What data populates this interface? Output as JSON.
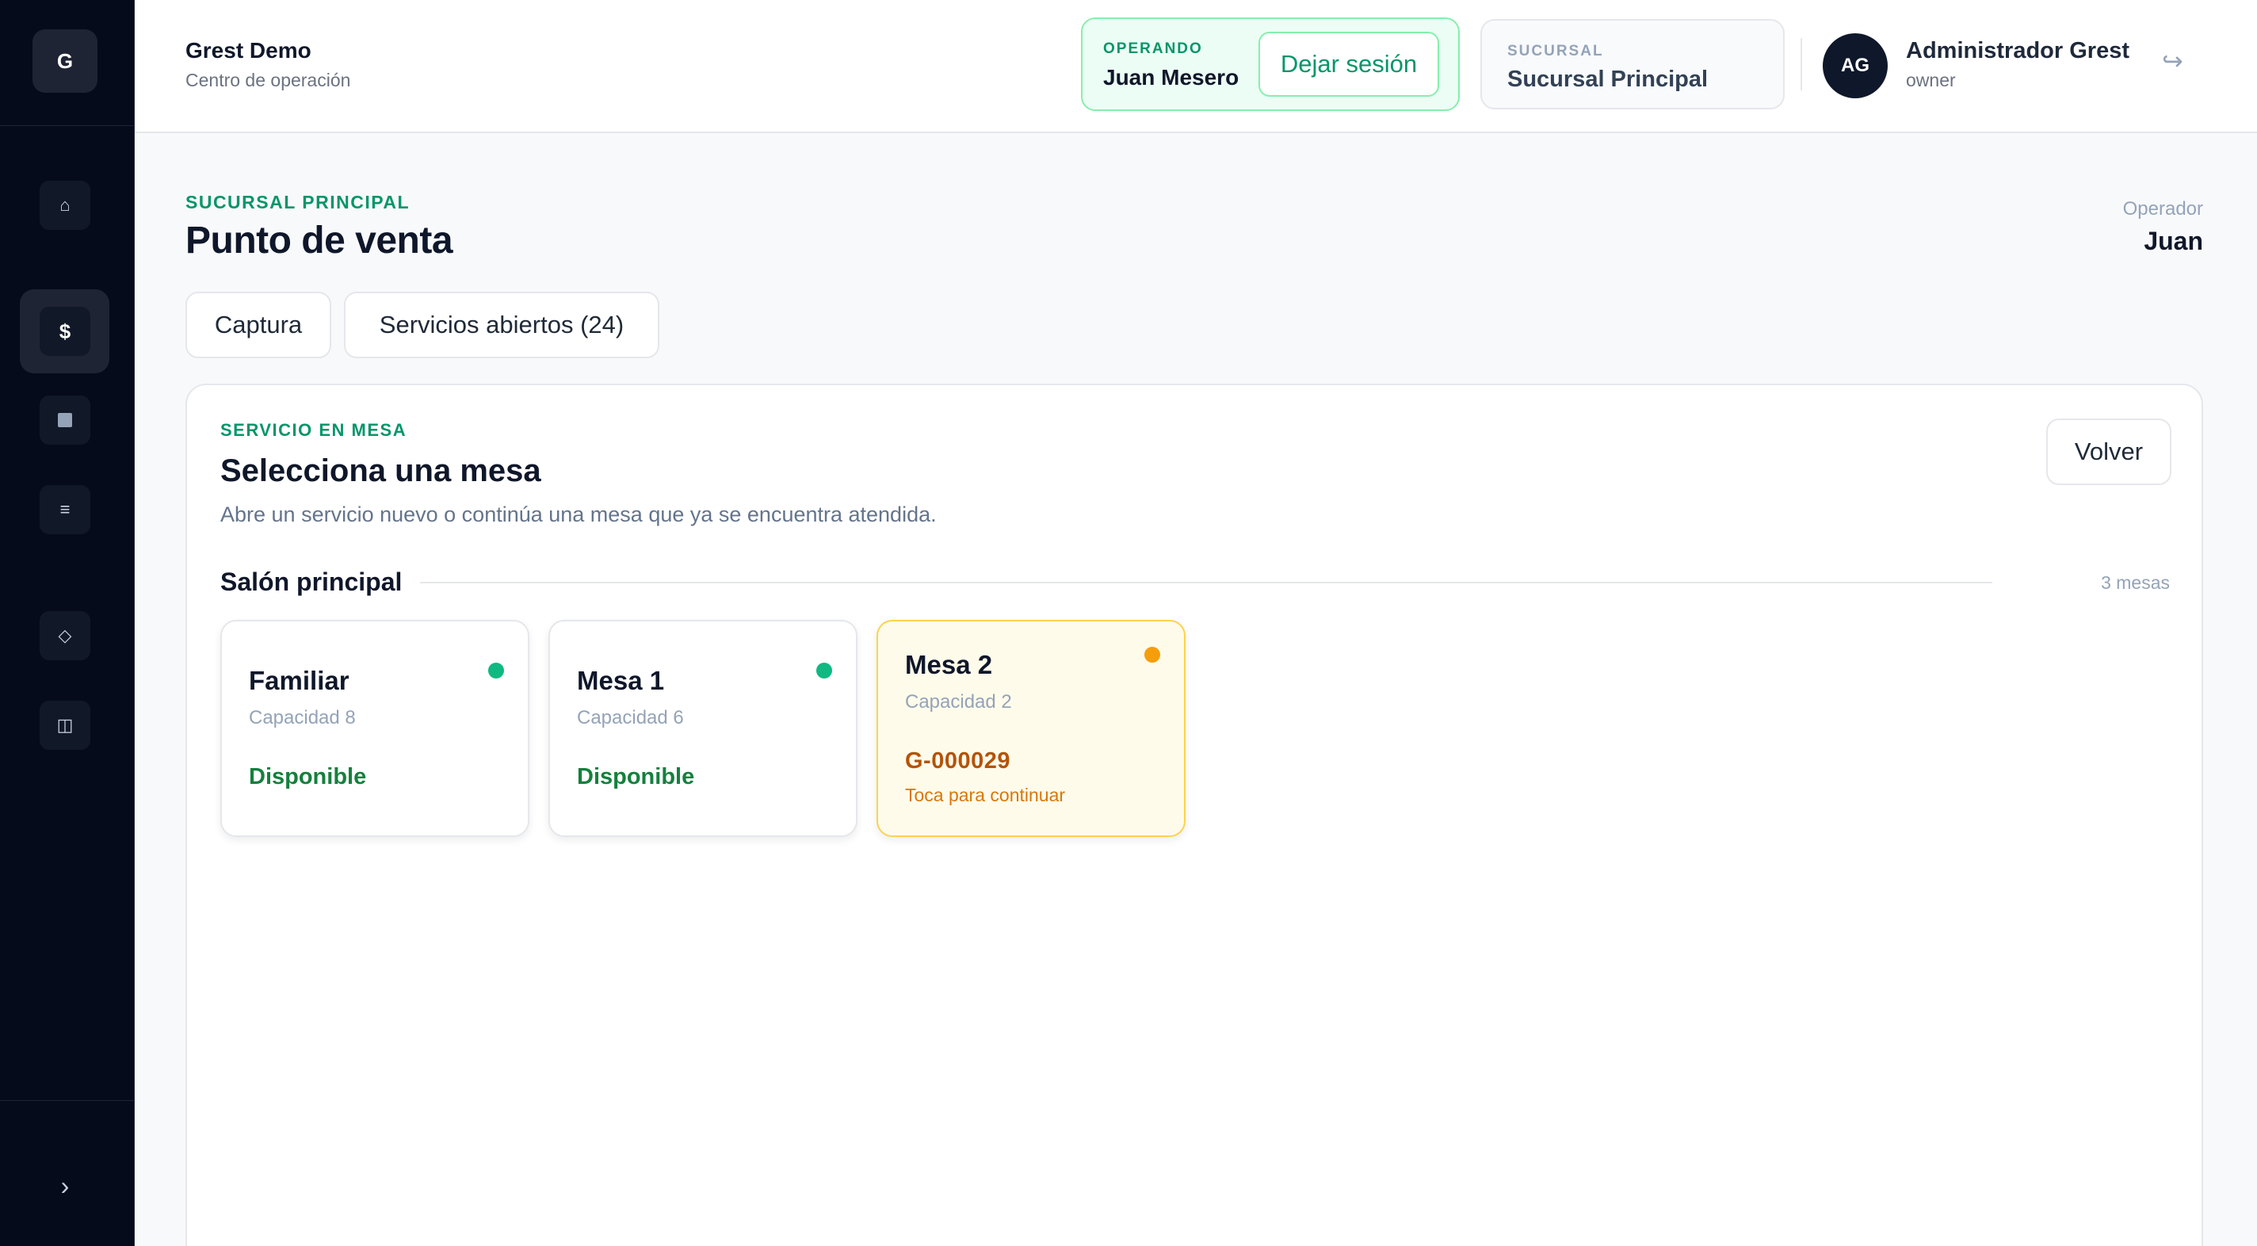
{
  "sidebar": {
    "logo": "G",
    "items": [
      {
        "name": "home",
        "icon": "home-icon",
        "glyph": "⌂"
      },
      {
        "name": "pos",
        "icon": "dollar-icon",
        "glyph": "$"
      },
      {
        "name": "tables",
        "icon": "grid-icon",
        "glyph": ""
      },
      {
        "name": "menu",
        "icon": "list-icon",
        "glyph": "≡"
      },
      {
        "name": "tags",
        "icon": "diamond-icon",
        "glyph": "◇"
      },
      {
        "name": "reports",
        "icon": "panel-icon",
        "glyph": "◫"
      }
    ],
    "collapse_glyph": "›"
  },
  "header": {
    "title": "Grest Demo",
    "subtitle": "Centro de operación",
    "operando": {
      "label": "OPERANDO",
      "name": "Juan Mesero",
      "leave_label": "Dejar sesión"
    },
    "sucursal": {
      "label": "SUCURSAL",
      "name": "Sucursal Principal"
    },
    "user": {
      "initials": "AG",
      "name": "Administrador Grest",
      "role": "owner"
    },
    "logout_glyph": "↪"
  },
  "page": {
    "eyebrow": "SUCURSAL PRINCIPAL",
    "title": "Punto de venta",
    "operator_label": "Operador",
    "operator_name": "Juan",
    "tabs": [
      {
        "label": "Captura"
      },
      {
        "label": "Servicios abiertos (24)"
      }
    ]
  },
  "panel": {
    "eyebrow": "SERVICIO EN MESA",
    "title": "Selecciona una mesa",
    "description": "Abre un servicio nuevo o continúa una mesa que ya se encuentra atendida.",
    "back_label": "Volver",
    "section": {
      "title": "Salón principal",
      "count": "3 mesas"
    },
    "tables": [
      {
        "name": "Familiar",
        "capacity": "Capacidad 8",
        "status": "Disponible"
      },
      {
        "name": "Mesa 1",
        "capacity": "Capacidad 6",
        "status": "Disponible"
      },
      {
        "name": "Mesa 2",
        "capacity": "Capacidad 2",
        "order": "G-000029",
        "hint": "Toca para continuar"
      }
    ]
  },
  "colors": {
    "accent_green": "#059669",
    "available": "#10b981",
    "occupied": "#f59e0b",
    "sidebar_bg": "#060b1c"
  }
}
